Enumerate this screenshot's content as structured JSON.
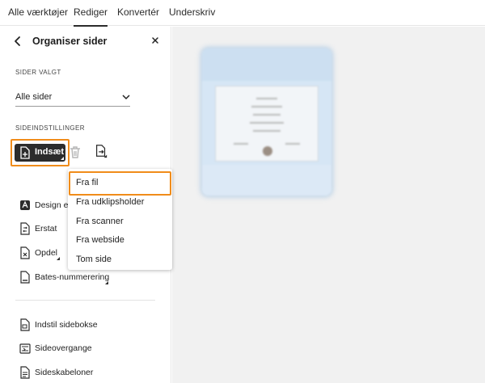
{
  "top_nav": {
    "tabs": [
      {
        "label": "Alle værktøjer",
        "active": false
      },
      {
        "label": "Rediger",
        "active": true
      },
      {
        "label": "Konvertér",
        "active": false
      },
      {
        "label": "Underskriv",
        "active": false
      }
    ]
  },
  "panel": {
    "title": "Organiser sider",
    "pages_selected_label": "SIDER VALGT",
    "pages_dropdown_value": "Alle sider",
    "page_settings_label": "SIDEINDSTILLINGER",
    "insert_label": "Indsæt",
    "tools": {
      "design": "Design en",
      "replace": "Erstat",
      "split": "Opdel",
      "bates": "Bates-nummerering",
      "set_page_box": "Indstil sidebokse",
      "page_transitions": "Sideovergange",
      "page_templates": "Sideskabeloner"
    }
  },
  "insert_menu": {
    "items": [
      "Fra fil",
      "Fra udklipsholder",
      "Fra scanner",
      "Fra webside",
      "Tom side"
    ]
  },
  "colors": {
    "highlight": "#f08c1a",
    "insert_button_bg": "#2c2c2c",
    "canvas_bg": "#f1f1f1",
    "thumbnail_selection": "#d6e6f5"
  },
  "icons": [
    "back-arrow-icon",
    "close-icon",
    "chevron-down-icon",
    "rotate-left-icon",
    "rotate-right-icon",
    "trash-icon",
    "extract-page-icon",
    "insert-page-icon",
    "design-icon",
    "replace-icon",
    "split-icon",
    "bates-icon",
    "page-box-icon",
    "transition-icon",
    "template-icon"
  ]
}
